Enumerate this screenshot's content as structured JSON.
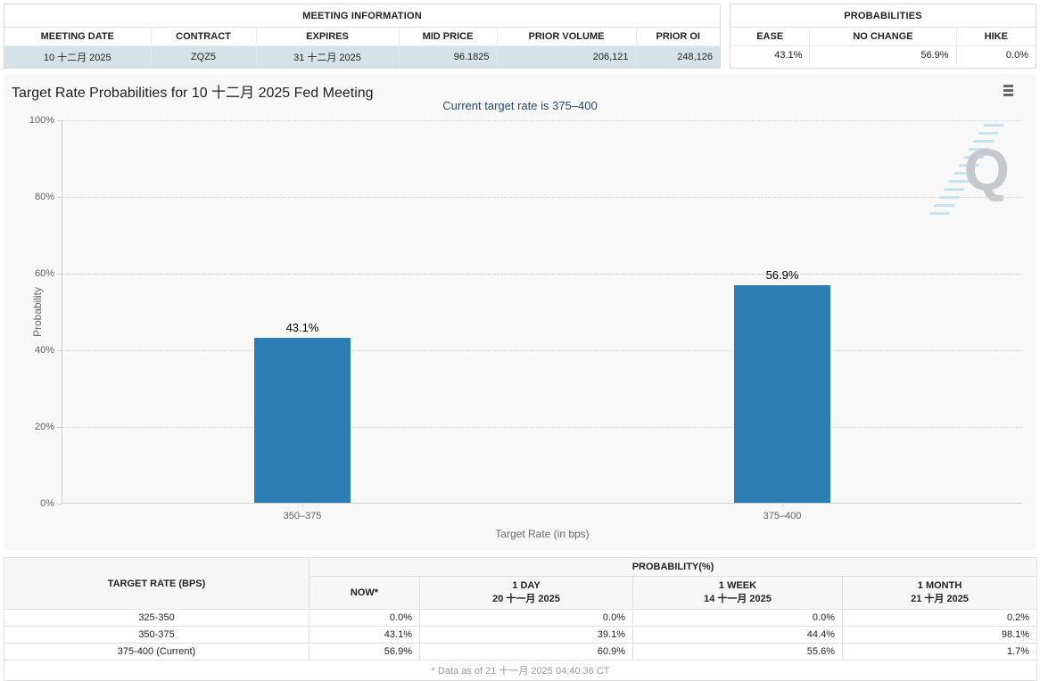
{
  "meeting_information": {
    "title": "MEETING INFORMATION",
    "columns": [
      "MEETING DATE",
      "CONTRACT",
      "EXPIRES",
      "MID PRICE",
      "PRIOR VOLUME",
      "PRIOR OI"
    ],
    "row": {
      "meeting_date": "10 十二月 2025",
      "contract": "ZQZ5",
      "expires": "31 十二月 2025",
      "mid_price": "96.1825",
      "prior_volume": "206,121",
      "prior_oi": "248,126"
    }
  },
  "probabilities_panel": {
    "title": "PROBABILITIES",
    "columns": [
      "EASE",
      "NO CHANGE",
      "HIKE"
    ],
    "row": {
      "ease": "43.1%",
      "no_change": "56.9%",
      "hike": "0.0%"
    }
  },
  "chart_data": {
    "type": "bar",
    "title": "Target Rate Probabilities for 10 十二月 2025 Fed Meeting",
    "subtitle": "Current target rate is 375–400",
    "categories": [
      "350–375",
      "375–400"
    ],
    "values": [
      43.1,
      56.9
    ],
    "value_labels": [
      "43.1%",
      "56.9%"
    ],
    "xlabel": "Target Rate (in bps)",
    "ylabel": "Probability",
    "ylim": [
      0,
      100
    ],
    "y_ticks": [
      "0%",
      "20%",
      "40%",
      "60%",
      "80%",
      "100%"
    ],
    "grid": "horizontal dotted",
    "legend": "none",
    "bar_color": "#2d7db5",
    "watermark_letter": "Q"
  },
  "bottom_table": {
    "corner_header": "TARGET RATE (BPS)",
    "group_header": "PROBABILITY(%)",
    "sub_headers": [
      [
        "NOW*"
      ],
      [
        "1 DAY",
        "20 十一月 2025"
      ],
      [
        "1 WEEK",
        "14 十一月 2025"
      ],
      [
        "1 MONTH",
        "21 十月 2025"
      ]
    ],
    "rows": [
      {
        "target_rate": "325-350",
        "now": "0.0%",
        "day": "0.0%",
        "week": "0.0%",
        "month": "0.2%"
      },
      {
        "target_rate": "350-375",
        "now": "43.1%",
        "day": "39.1%",
        "week": "44.4%",
        "month": "98.1%"
      },
      {
        "target_rate": "375-400 (Current)",
        "now": "56.9%",
        "day": "60.9%",
        "week": "55.6%",
        "month": "1.7%"
      }
    ],
    "footnote": "* Data as of 21 十一月 2025 04:40:36 CT"
  },
  "colors": {
    "bar": "#2d7db5",
    "subtitle_text": "#274b6d",
    "now_column_highlight": "#f6f6d8",
    "meeting_row_highlight": "#d6e3e6",
    "watermark_stripes": "#b9e0f2"
  }
}
